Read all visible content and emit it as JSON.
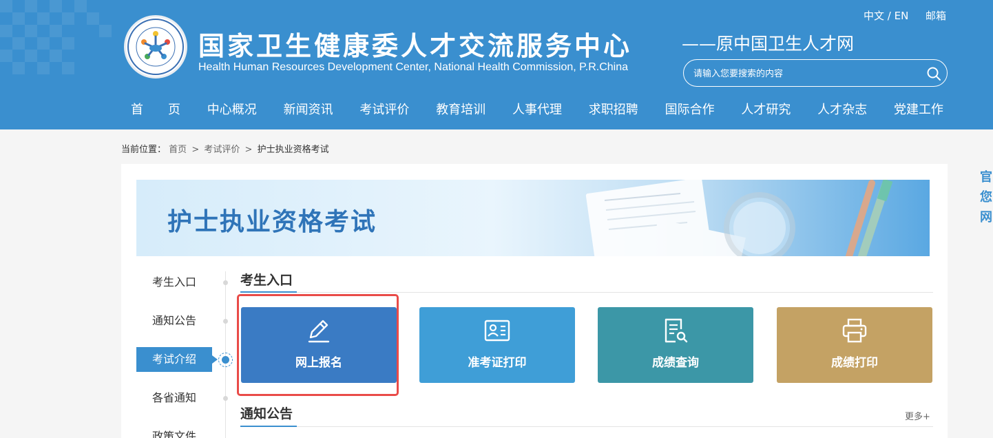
{
  "header": {
    "title": "国家卫生健康委人才交流服务中心",
    "subtitle_en": "Health Human Resources Development Center, National Health Commission, P.R.China",
    "slogan": "——原中国卫生人才网",
    "lang_link": "中文 / EN",
    "mail_link": "邮箱",
    "search_placeholder": "请输入您要搜索的内容",
    "colors": {
      "primary": "#3a8fcf",
      "text": "#ffffff"
    }
  },
  "nav": {
    "items": [
      "首　　页",
      "中心概况",
      "新闻资讯",
      "考试评价",
      "教育培训",
      "人事代理",
      "求职招聘",
      "国际合作",
      "人才研究",
      "人才杂志",
      "党建工作"
    ]
  },
  "breadcrumb": {
    "prefix": "当前位置：",
    "items": [
      "首页",
      "考试评价",
      "护士执业资格考试"
    ],
    "separator": ">"
  },
  "banner": {
    "title": "护士执业资格考试"
  },
  "side_menu": {
    "items": [
      "考生入口",
      "通知公告",
      "考试介绍",
      "各省通知",
      "政策文件"
    ],
    "active_index": 2
  },
  "sections": {
    "entry_title": "考生入口",
    "notice_title": "通知公告",
    "more_label": "更多+"
  },
  "tiles": [
    {
      "label": "网上报名",
      "icon": "pencil-icon",
      "color": "#3a7bc4"
    },
    {
      "label": "准考证打印",
      "icon": "id-card-icon",
      "color": "#3f9ed7"
    },
    {
      "label": "成绩查询",
      "icon": "document-search-icon",
      "color": "#3c97a7"
    },
    {
      "label": "成绩打印",
      "icon": "printer-icon",
      "color": "#c4a264"
    }
  ],
  "highlight_color": "#e94b48",
  "side_float": {
    "lines": [
      "官",
      "您",
      "网"
    ]
  }
}
